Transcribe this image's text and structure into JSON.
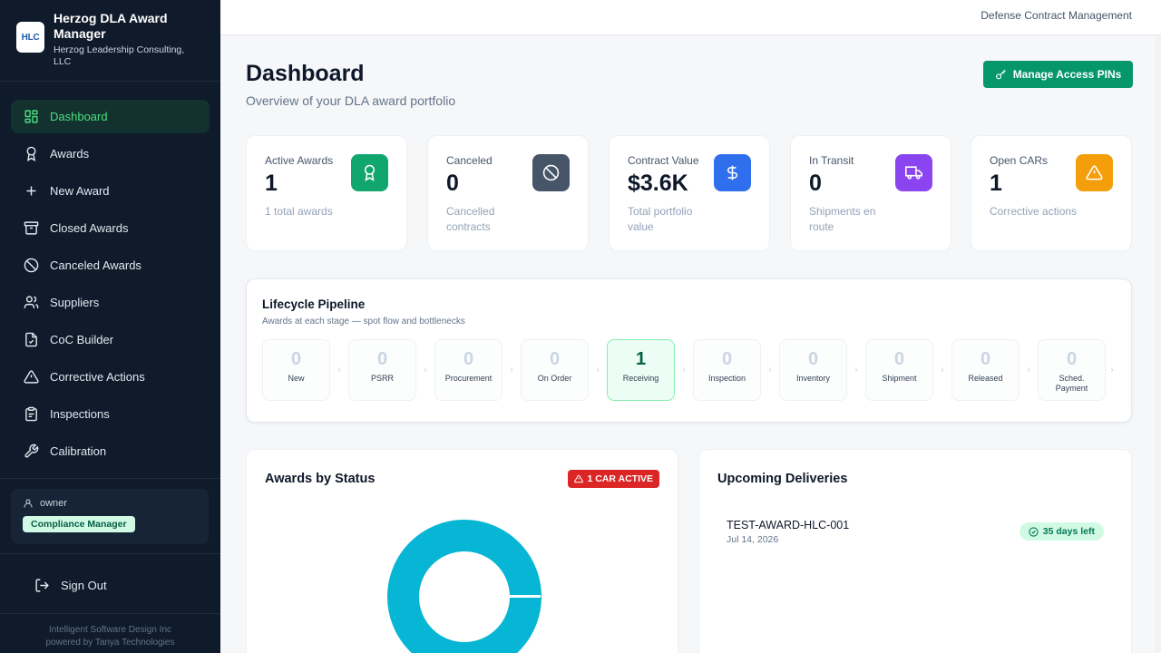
{
  "brand": {
    "logo_text": "HLC",
    "title": "Herzog DLA Award Manager",
    "subtitle": "Herzog Leadership Consulting, LLC"
  },
  "nav": {
    "items": [
      {
        "label": "Dashboard",
        "icon": "dashboard-grid-icon",
        "active": true
      },
      {
        "label": "Awards",
        "icon": "award-icon"
      },
      {
        "label": "New Award",
        "icon": "plus-icon"
      },
      {
        "label": "Closed Awards",
        "icon": "archive-icon"
      },
      {
        "label": "Canceled Awards",
        "icon": "ban-icon"
      },
      {
        "label": "Suppliers",
        "icon": "users-icon"
      },
      {
        "label": "CoC Builder",
        "icon": "document-icon"
      },
      {
        "label": "Corrective Actions",
        "icon": "warning-icon"
      },
      {
        "label": "Inspections",
        "icon": "clipboard-icon"
      },
      {
        "label": "Calibration",
        "icon": "wrench-icon"
      }
    ]
  },
  "user": {
    "name": "owner",
    "role": "Compliance Manager"
  },
  "signout_label": "Sign Out",
  "footer": {
    "line1": "Intelligent Software Design Inc",
    "line2": "powered by Tanya Technologies"
  },
  "topbar": {
    "right_text": "Defense Contract Management"
  },
  "page": {
    "title": "Dashboard",
    "subtitle": "Overview of your DLA award portfolio",
    "pin_button": "Manage Access PINs"
  },
  "colors": {
    "accent": "#059669",
    "active_awards": "#10a66e",
    "canceled": "#475569",
    "contract_value": "#2f6fed",
    "in_transit": "#8b45f0",
    "open_cars": "#f59e0b",
    "donut": "#06b6d4",
    "danger": "#dc2626"
  },
  "stats": [
    {
      "label": "Active Awards",
      "value": "1",
      "desc": "1 total awards",
      "icon": "award-icon"
    },
    {
      "label": "Canceled",
      "value": "0",
      "desc": "Cancelled contracts",
      "icon": "ban-icon"
    },
    {
      "label": "Contract Value",
      "value": "$3.6K",
      "desc": "Total portfolio value",
      "icon": "dollar-icon"
    },
    {
      "label": "In Transit",
      "value": "0",
      "desc": "Shipments en route",
      "icon": "truck-icon"
    },
    {
      "label": "Open CARs",
      "value": "1",
      "desc": "Corrective actions",
      "icon": "warning-icon"
    }
  ],
  "pipeline": {
    "title": "Lifecycle Pipeline",
    "subtitle": "Awards at each stage — spot flow and bottlenecks",
    "stages": [
      {
        "name": "New",
        "count": "0"
      },
      {
        "name": "PSRR",
        "count": "0"
      },
      {
        "name": "Procurement",
        "count": "0"
      },
      {
        "name": "On Order",
        "count": "0"
      },
      {
        "name": "Receiving",
        "count": "1",
        "highlight": true
      },
      {
        "name": "Inspection",
        "count": "0"
      },
      {
        "name": "Inventory",
        "count": "0"
      },
      {
        "name": "Shipment",
        "count": "0"
      },
      {
        "name": "Released",
        "count": "0"
      },
      {
        "name": "Sched. Payment",
        "count": "0"
      }
    ]
  },
  "status_card": {
    "title": "Awards by Status",
    "badge": "1 CAR ACTIVE"
  },
  "deliveries": {
    "title": "Upcoming Deliveries",
    "items": [
      {
        "id": "TEST-AWARD-HLC-001",
        "date": "Jul 14, 2026",
        "badge": "35 days left"
      }
    ]
  }
}
